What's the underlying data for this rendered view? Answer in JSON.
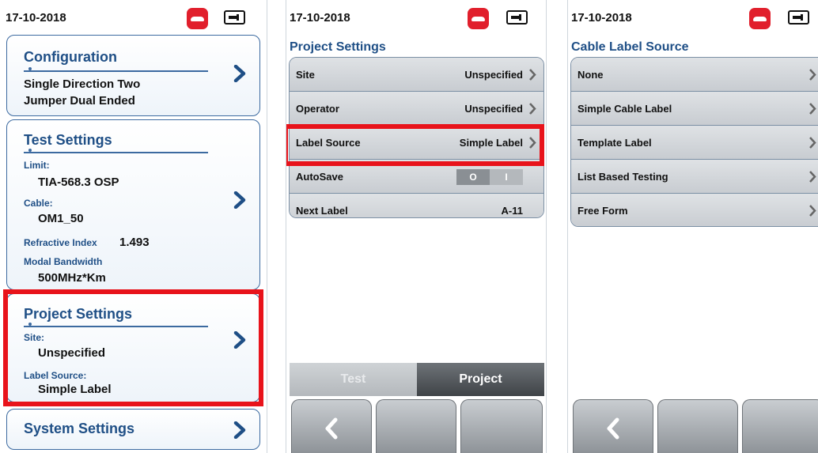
{
  "screen1": {
    "status": {
      "date": "17-10-2018"
    },
    "configuration": {
      "title": "Configuration",
      "line1": "Single Direction Two",
      "line2": "Jumper Dual Ended"
    },
    "test_settings": {
      "title": "Test Settings",
      "limit_label": "Limit:",
      "limit_value": "TIA-568.3 OSP",
      "cable_label": "Cable:",
      "cable_value": "OM1_50",
      "refractive_label": "Refractive Index",
      "refractive_value": "1.493",
      "modal_label": "Modal Bandwidth",
      "modal_value": "500MHz*Km"
    },
    "project_settings": {
      "title": "Project Settings",
      "site_label": "Site:",
      "site_value": "Unspecified",
      "label_source_label": "Label Source:",
      "label_source_value": "Simple Label"
    },
    "system_settings": {
      "title": "System Settings"
    }
  },
  "screen2": {
    "status": {
      "date": "17-10-2018"
    },
    "heading": "Project Settings",
    "rows": [
      {
        "label": "Site",
        "value": "Unspecified"
      },
      {
        "label": "Operator",
        "value": "Unspecified"
      },
      {
        "label": "Label Source",
        "value": "Simple Label"
      },
      {
        "label": "AutoSave",
        "toggle_on": "O",
        "toggle_off": "I"
      },
      {
        "label": "Next Label",
        "value": "A-11"
      }
    ],
    "tabs": {
      "test": "Test",
      "project": "Project"
    }
  },
  "screen3": {
    "status": {
      "date": "17-10-2018"
    },
    "heading": "Cable Label Source",
    "options": [
      "None",
      "Simple Cable Label",
      "Template Label",
      "List Based Testing",
      "Free Form"
    ]
  },
  "colors": {
    "accent": "#1f4f86",
    "highlight": "#e8131b",
    "phone": "#e11f2c"
  },
  "icons": [
    "phone-hangup-icon",
    "battery-icon",
    "chevron-right-icon",
    "back-arrow-icon"
  ]
}
